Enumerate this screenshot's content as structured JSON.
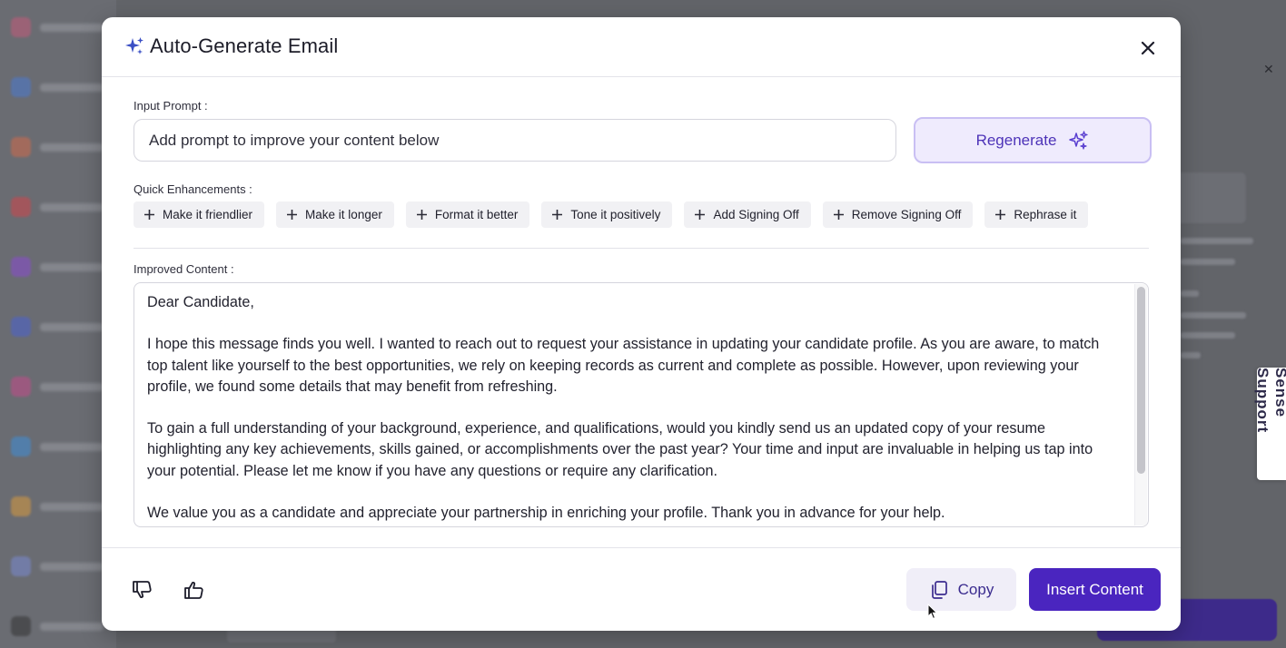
{
  "background": {
    "support_tab_label": "Sense Support"
  },
  "modal": {
    "title": "Auto-Generate Email",
    "input_prompt_label": "Input Prompt :",
    "input_prompt_placeholder": "Add prompt to improve your content below",
    "regenerate_label": "Regenerate",
    "quick_enhancements_label": "Quick Enhancements :",
    "quick_enhancements": [
      "Make it friendlier",
      "Make it longer",
      "Format it better",
      "Tone it positively",
      "Add Signing Off",
      "Remove Signing Off",
      "Rephrase it"
    ],
    "improved_content_label": "Improved Content :",
    "improved_content": {
      "greeting": "Dear Candidate,",
      "paragraph_1": "I hope this message finds you well. I wanted to reach out to request your assistance in updating your candidate profile. As you are aware, to match top talent like yourself to the best opportunities, we rely on keeping records as current and complete as possible. However, upon reviewing your profile, we found some details that may benefit from refreshing.",
      "paragraph_2": "To gain a full understanding of your background, experience, and qualifications, would you kindly send us an updated copy of your resume highlighting any key achievements, skills gained, or accomplishments over the past year? Your time and input are invaluable in helping us tap into your potential. Please let me know if you have any questions or require any clarification.",
      "paragraph_3": "We value you as a candidate and appreciate your partnership in enriching your profile. Thank you in advance for your help."
    },
    "copy_label": "Copy",
    "insert_label": "Insert Content"
  },
  "colors": {
    "accent": "#4a25bf",
    "regenerate_bg": "#efebfd",
    "regenerate_border": "#c9bff3"
  }
}
